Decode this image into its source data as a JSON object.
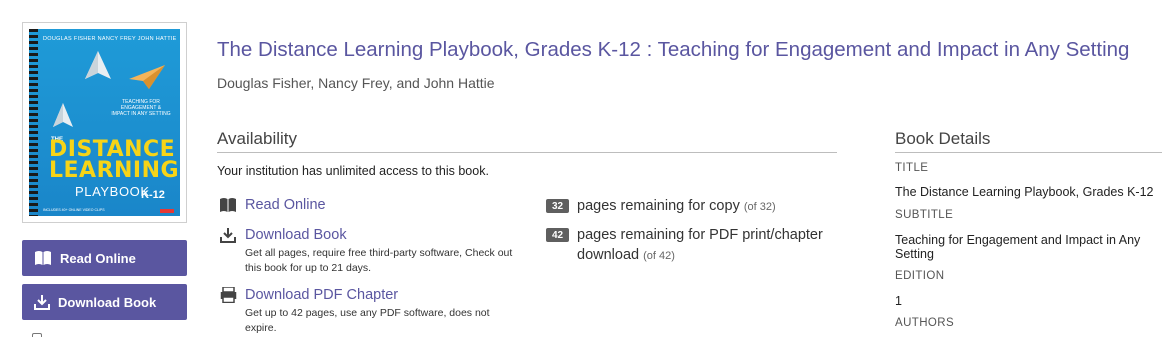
{
  "cover": {
    "authors": "DOUGLAS FISHER   NANCY FREY   JOHN HATTIE",
    "subtitle": "TEACHING FOR ENGAGEMENT & IMPACT IN ANY SETTING",
    "the": "THE",
    "title_line1": "DISTANCE",
    "title_line2": "LEARNING",
    "playbook": "PLAYBOOK",
    "grades": "K-12",
    "footer": "INCLUDES 40+ ONLINE VIDEO CLIPS",
    "accent": "#f7d417"
  },
  "sidebar": {
    "read_online": "Read Online",
    "download_book": "Download Book",
    "button_color": "#5a56a0"
  },
  "book": {
    "title": "The Distance Learning Playbook, Grades K-12 : Teaching for Engagement and Impact in Any Setting",
    "authors": "Douglas Fisher, Nancy Frey, and John Hattie"
  },
  "availability": {
    "heading": "Availability",
    "access_note": "Your institution has unlimited access to this book.",
    "options": [
      {
        "label": "Read Online",
        "description": "",
        "icon": "book-open-icon"
      },
      {
        "label": "Download Book",
        "description": "Get all pages, require free third-party software, Check out this book for up to 21 days.",
        "icon": "download-icon"
      },
      {
        "label": "Download PDF Chapter",
        "description": "Get up to 42 pages, use any PDF software, does not expire.",
        "icon": "pdf-icon"
      }
    ],
    "quotas": [
      {
        "count": "32",
        "text": "pages remaining for copy",
        "of": "(of 32)"
      },
      {
        "count": "42",
        "text": "pages remaining for PDF print/chapter download",
        "of": "(of 42)"
      }
    ]
  },
  "details": {
    "heading": "Book Details",
    "title_label": "TITLE",
    "title_value": "The Distance Learning Playbook, Grades K-12",
    "subtitle_label": "SUBTITLE",
    "subtitle_value": "Teaching for Engagement and Impact in Any Setting",
    "edition_label": "EDITION",
    "edition_value": "1",
    "authors_label": "AUTHORS"
  }
}
